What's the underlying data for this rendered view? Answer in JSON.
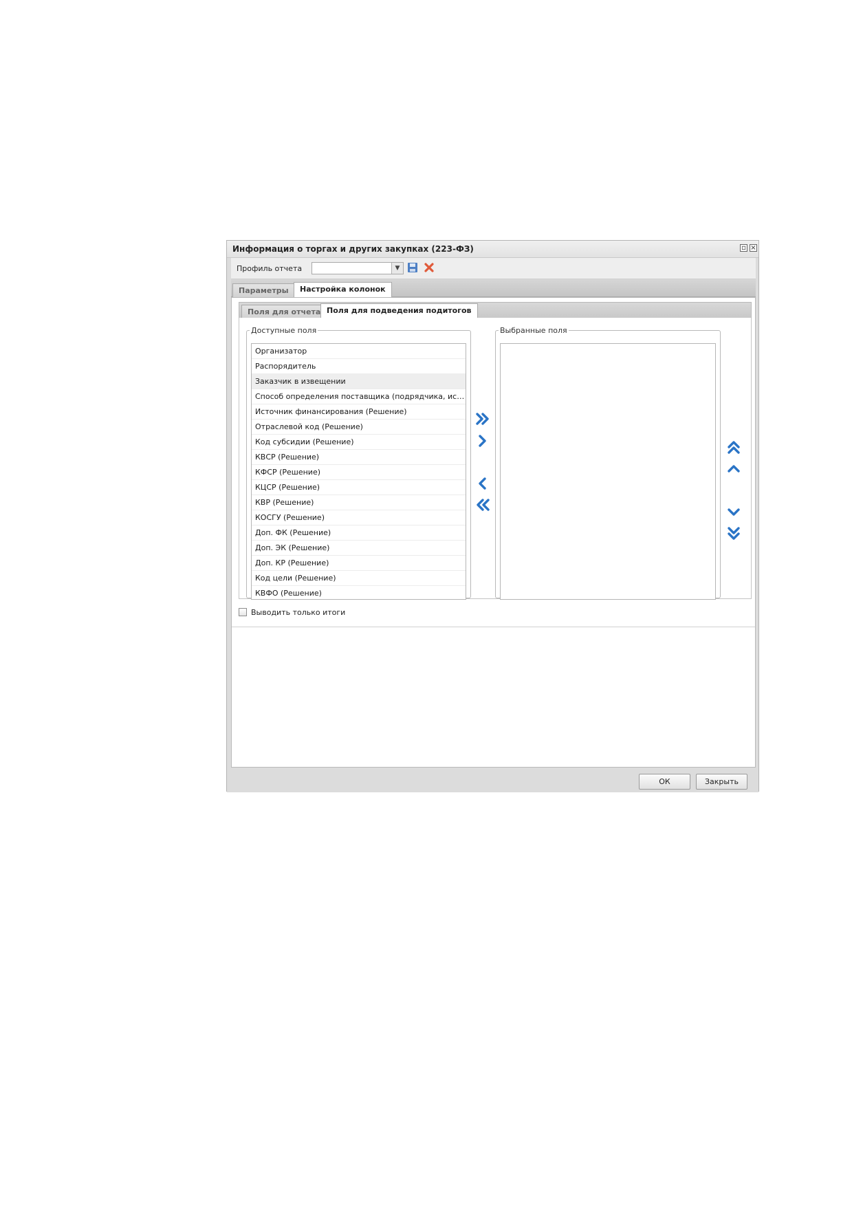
{
  "window": {
    "title": "Информация о торгах и других закупках (223-ФЗ)",
    "restore_icon": "restore-icon",
    "close_icon": "close-icon"
  },
  "profile": {
    "label": "Профиль отчета",
    "value": "",
    "save_icon": "save-icon",
    "delete_icon": "delete-icon"
  },
  "tabs": [
    {
      "label": "Параметры",
      "active": false
    },
    {
      "label": "Настройка колонок",
      "active": true
    }
  ],
  "subtabs": [
    {
      "label": "Поля для отчета",
      "active": false
    },
    {
      "label": "Поля для подведения подитогов",
      "active": true
    }
  ],
  "available": {
    "legend": "Доступные поля",
    "items": [
      "Организатор",
      "Распорядитель",
      "Заказчик в извещении",
      "Способ определения поставщика (подрядчика, исполн...",
      "Источник финансирования (Решение)",
      "Отраслевой код (Решение)",
      "Код субсидии (Решение)",
      "КВСР (Решение)",
      "КФСР (Решение)",
      "КЦСР (Решение)",
      "КВР (Решение)",
      "КОСГУ (Решение)",
      "Доп. ФК (Решение)",
      "Доп. ЭК (Решение)",
      "Доп. КР (Решение)",
      "Код цели (Решение)",
      "КВФО (Решение)"
    ],
    "highlighted_index": 2
  },
  "selected": {
    "legend": "Выбранные поля",
    "items": []
  },
  "totals_only": {
    "label": "Выводить только итоги",
    "checked": false
  },
  "buttons": {
    "ok": "ОК",
    "close": "Закрыть"
  },
  "colors": {
    "arrow": "#2a74c6",
    "delete": "#e05a3a",
    "save": "#4d7fc4"
  }
}
